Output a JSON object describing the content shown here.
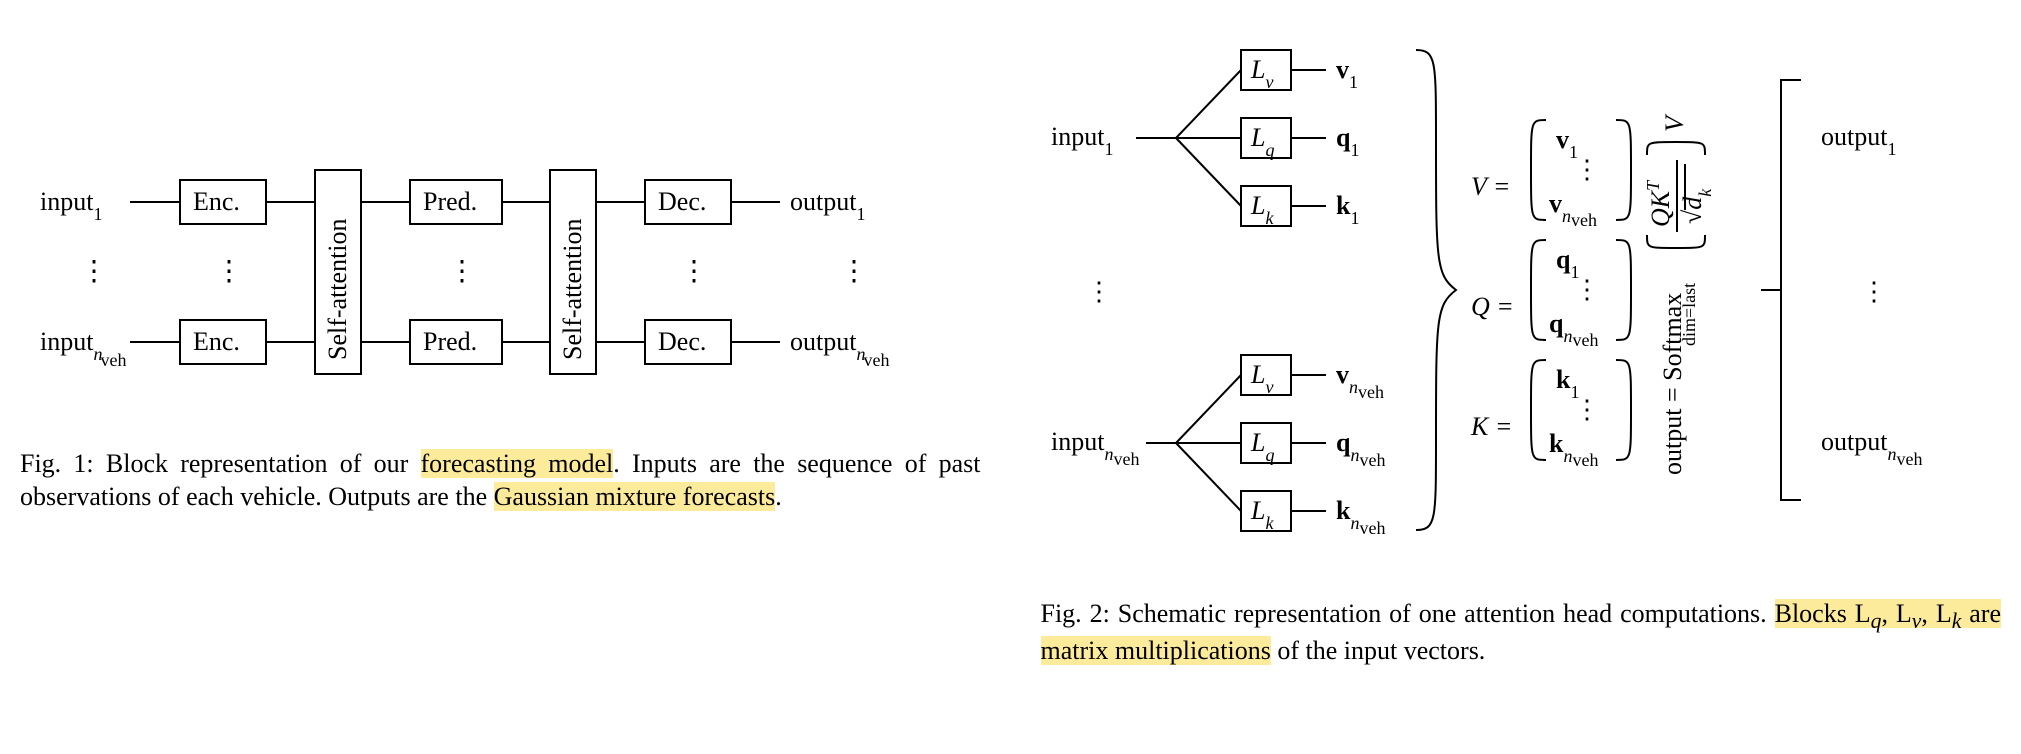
{
  "fig1": {
    "input1": "input",
    "inputn_prefix": "input",
    "output1": "output",
    "outputn_prefix": "output",
    "enc": "Enc.",
    "pred": "Pred.",
    "dec": "Dec.",
    "selfatt": "Self-attention",
    "sub_nveh": "n",
    "sub_veh": "veh",
    "caption_lead": "Fig. 1: Block representation of our ",
    "caption_hl1": "forecasting model",
    "caption_mid": ". Inputs are the sequence of past observations of each vehicle. Outputs are the ",
    "caption_hl2": "Gaussian mixture forecasts",
    "caption_tail": "."
  },
  "fig2": {
    "input1": "input",
    "inputn": "input",
    "output1": "output",
    "outputn": "output",
    "Lv": "L",
    "Lv_sub": "v",
    "Lq": "L",
    "Lq_sub": "q",
    "Lk": "L",
    "Lk_sub": "k",
    "v1": "v",
    "q1": "q",
    "k1": "k",
    "V": "V =",
    "Q": "Q =",
    "K": "K =",
    "softmax": "output = Softmax",
    "dimlast": "dim=last",
    "QKT": "QK",
    "T": "T",
    "sqrt": "√",
    "dk": "d",
    "dk_sub": "k",
    "Vtail": "V",
    "caption_lead": "Fig. 2: Schematic representation of one attention head computations. ",
    "caption_hl": "Blocks L",
    "caption_hl_q": "q",
    "caption_hl_mid1": ", L",
    "caption_hl_v": "v",
    "caption_hl_mid2": ", L",
    "caption_hl_k": "k",
    "caption_hl_tail": " are matrix multiplications",
    "caption_tail": " of the input vectors."
  }
}
